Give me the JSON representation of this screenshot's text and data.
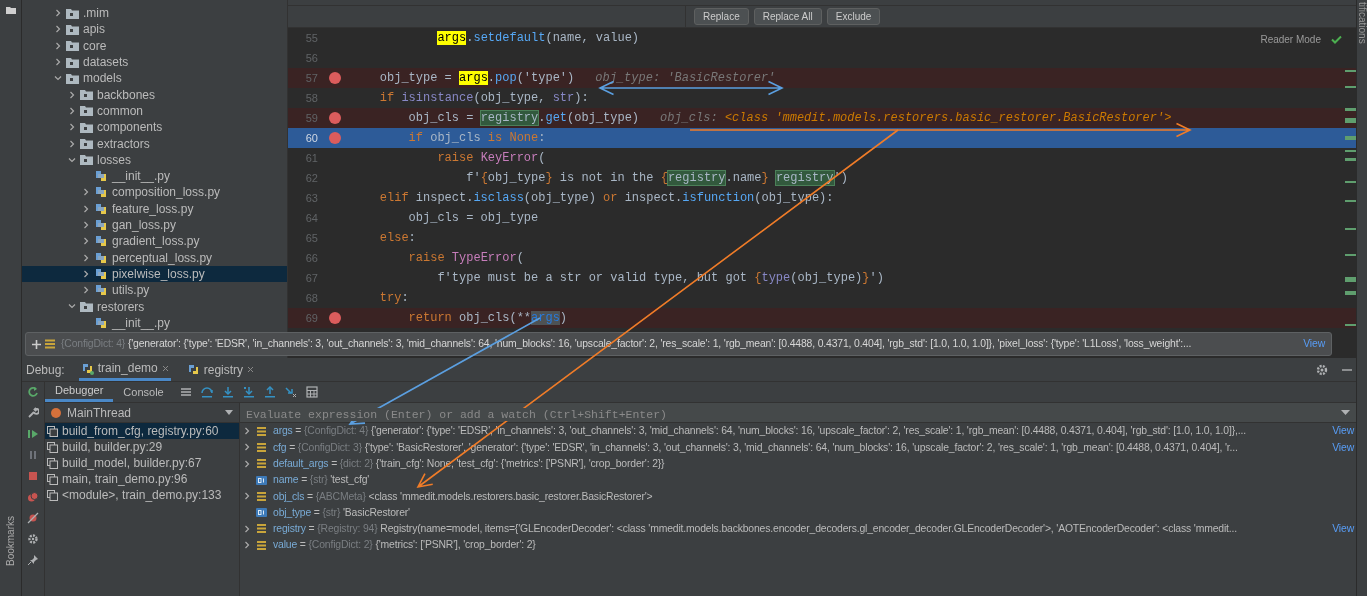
{
  "project_tree": [
    {
      "label": ".mim",
      "kind": "folder",
      "expanded": false,
      "selected": false
    },
    {
      "label": "apis",
      "kind": "folder",
      "expanded": false,
      "selected": false
    },
    {
      "label": "core",
      "kind": "folder",
      "expanded": false,
      "selected": false
    },
    {
      "label": "datasets",
      "kind": "folder",
      "expanded": false,
      "selected": false
    },
    {
      "label": "models",
      "kind": "folder",
      "expanded": true,
      "selected": false,
      "children": [
        {
          "label": "backbones",
          "kind": "folder",
          "expanded": false,
          "selected": false
        },
        {
          "label": "common",
          "kind": "folder",
          "expanded": false,
          "selected": false
        },
        {
          "label": "components",
          "kind": "folder",
          "expanded": false,
          "selected": false
        },
        {
          "label": "extractors",
          "kind": "folder",
          "expanded": false,
          "selected": false
        },
        {
          "label": "losses",
          "kind": "folder",
          "expanded": true,
          "selected": false,
          "children": [
            {
              "label": "__init__.py",
              "kind": "file",
              "selected": false
            },
            {
              "label": "composition_loss.py",
              "kind": "file",
              "expanded": false,
              "selected": false
            },
            {
              "label": "feature_loss.py",
              "kind": "file",
              "expanded": false,
              "selected": false
            },
            {
              "label": "gan_loss.py",
              "kind": "file",
              "expanded": false,
              "selected": false
            },
            {
              "label": "gradient_loss.py",
              "kind": "file",
              "expanded": false,
              "selected": false
            },
            {
              "label": "perceptual_loss.py",
              "kind": "file",
              "expanded": false,
              "selected": false
            },
            {
              "label": "pixelwise_loss.py",
              "kind": "file",
              "expanded": false,
              "selected": true
            },
            {
              "label": "utils.py",
              "kind": "file",
              "expanded": false,
              "selected": false
            }
          ]
        },
        {
          "label": "restorers",
          "kind": "folder",
          "expanded": true,
          "selected": false,
          "children": [
            {
              "label": "__init__.py",
              "kind": "file",
              "selected": false
            }
          ]
        }
      ]
    }
  ],
  "find_bar": {
    "buttons": [
      "Replace",
      "Replace All",
      "Exclude"
    ]
  },
  "editor": {
    "reader_mode": "Reader Mode",
    "lines": [
      {
        "number": "55",
        "breakpoint": false,
        "current": false,
        "tokens": [
          {
            "text": "            args",
            "kind": "match"
          },
          {
            "text": ".",
            "kind": "plain"
          },
          {
            "text": "setdefault",
            "kind": "call"
          },
          {
            "text": "(name, value)",
            "kind": "plain"
          }
        ]
      },
      {
        "number": "56",
        "breakpoint": false,
        "current": false
      },
      {
        "number": "57",
        "breakpoint": true,
        "current": false,
        "tokens": [
          {
            "text": "    obj_type = ",
            "kind": "plain"
          },
          {
            "text": "args",
            "kind": "match"
          },
          {
            "text": ".",
            "kind": "plain"
          },
          {
            "text": "pop",
            "kind": "call"
          },
          {
            "text": "('type')",
            "kind": "plain"
          }
        ],
        "hint": [
          {
            "text": "obj_type: 'BasicRestorer'",
            "kind": "hint"
          }
        ]
      },
      {
        "number": "58",
        "breakpoint": false,
        "current": false,
        "tokens": [
          {
            "text": "    if ",
            "kind": "kw"
          },
          {
            "text": "isinstance",
            "kind": "builtin"
          },
          {
            "text": "(obj_type, ",
            "kind": "plain"
          },
          {
            "text": "str",
            "kind": "builtin"
          },
          {
            "text": "):",
            "kind": "plain"
          }
        ]
      },
      {
        "number": "59",
        "breakpoint": true,
        "current": false,
        "tokens": [
          {
            "text": "        obj_cls = ",
            "kind": "plain"
          },
          {
            "text": "registry",
            "kind": "ref"
          },
          {
            "text": ".",
            "kind": "plain"
          },
          {
            "text": "get",
            "kind": "call"
          },
          {
            "text": "(obj_type)",
            "kind": "plain"
          }
        ],
        "hint": [
          {
            "text": "obj_cls: ",
            "kind": "hint"
          },
          {
            "text": "<class 'mmedit.models.restorers.basic_restorer.BasicRestorer'>",
            "kind": "hint-value"
          }
        ]
      },
      {
        "number": "60",
        "breakpoint": true,
        "current": true,
        "tokens": [
          {
            "text": "        if ",
            "kind": "kw"
          },
          {
            "text": "obj_cls ",
            "kind": "plain"
          },
          {
            "text": "is None",
            "kind": "kw"
          },
          {
            "text": ":",
            "kind": "plain"
          }
        ]
      },
      {
        "number": "61",
        "breakpoint": false,
        "current": false,
        "tokens": [
          {
            "text": "            raise ",
            "kind": "kw"
          },
          {
            "text": "KeyError",
            "kind": "cls"
          },
          {
            "text": "(",
            "kind": "plain"
          }
        ]
      },
      {
        "number": "62",
        "breakpoint": false,
        "current": false,
        "tokens": [
          {
            "text": "                f'",
            "kind": "plain"
          },
          {
            "text": "{",
            "kind": "brace"
          },
          {
            "text": "obj_type",
            "kind": "plain"
          },
          {
            "text": "}",
            "kind": "brace"
          },
          {
            "text": " is not in the ",
            "kind": "plain"
          },
          {
            "text": "{",
            "kind": "brace"
          },
          {
            "text": "registry",
            "kind": "ref"
          },
          {
            "text": ".name",
            "kind": "plain"
          },
          {
            "text": "} ",
            "kind": "brace"
          },
          {
            "text": "registry",
            "kind": "ref"
          },
          {
            "text": "')",
            "kind": "plain"
          }
        ]
      },
      {
        "number": "63",
        "breakpoint": false,
        "current": false,
        "tokens": [
          {
            "text": "    elif ",
            "kind": "kw"
          },
          {
            "text": "inspect.",
            "kind": "plain"
          },
          {
            "text": "isclass",
            "kind": "call"
          },
          {
            "text": "(obj_type) ",
            "kind": "plain"
          },
          {
            "text": "or ",
            "kind": "kw"
          },
          {
            "text": "inspect.",
            "kind": "plain"
          },
          {
            "text": "isfunction",
            "kind": "call"
          },
          {
            "text": "(obj_type):",
            "kind": "plain"
          }
        ]
      },
      {
        "number": "64",
        "breakpoint": false,
        "current": false,
        "tokens": [
          {
            "text": "        obj_cls = obj_type",
            "kind": "plain"
          }
        ]
      },
      {
        "number": "65",
        "breakpoint": false,
        "current": false,
        "tokens": [
          {
            "text": "    else",
            "kind": "kw"
          },
          {
            "text": ":",
            "kind": "plain"
          }
        ]
      },
      {
        "number": "66",
        "breakpoint": false,
        "current": false,
        "tokens": [
          {
            "text": "        raise ",
            "kind": "kw"
          },
          {
            "text": "TypeError",
            "kind": "cls"
          },
          {
            "text": "(",
            "kind": "plain"
          }
        ]
      },
      {
        "number": "67",
        "breakpoint": false,
        "current": false,
        "tokens": [
          {
            "text": "            f'type must be a str or valid type, but got ",
            "kind": "plain"
          },
          {
            "text": "{",
            "kind": "brace"
          },
          {
            "text": "type",
            "kind": "builtin"
          },
          {
            "text": "(obj_type)",
            "kind": "plain"
          },
          {
            "text": "}",
            "kind": "brace"
          },
          {
            "text": "')",
            "kind": "plain"
          }
        ]
      },
      {
        "number": "68",
        "breakpoint": false,
        "current": false,
        "tokens": [
          {
            "text": "    try",
            "kind": "kw"
          },
          {
            "text": ":",
            "kind": "plain"
          }
        ]
      },
      {
        "number": "69",
        "breakpoint": true,
        "current": false,
        "tokens": [
          {
            "text": "        return ",
            "kind": "kw"
          },
          {
            "text": "obj_cls(**",
            "kind": "plain"
          },
          {
            "text": "args",
            "kind": "sel"
          },
          {
            "text": ")",
            "kind": "plain"
          }
        ]
      }
    ]
  },
  "tooltip": {
    "type": "{ConfigDict: 4}",
    "value": "{'generator': {'type': 'EDSR', 'in_channels': 3, 'out_channels': 3, 'mid_channels': 64, 'num_blocks': 16, 'upscale_factor': 2, 'res_scale': 1, 'rgb_mean': [0.4488, 0.4371, 0.404], 'rgb_std': [1.0, 1.0, 1.0]}, 'pixel_loss': {'type': 'L1Loss', 'loss_weight':...",
    "link": "View"
  },
  "annotations": [
    {
      "kind": "double-arrow",
      "color": "#5b9fe0"
    },
    {
      "kind": "arrow",
      "color": "#5b9fe0"
    },
    {
      "kind": "arrow",
      "color": "#f07c28"
    },
    {
      "kind": "arrow",
      "color": "#f07c28"
    }
  ],
  "debug": {
    "label": "Debug:",
    "sessions": [
      {
        "label": "train_demo",
        "selected": true
      },
      {
        "label": "registry",
        "selected": false
      }
    ],
    "tabs": [
      {
        "label": "Debugger",
        "selected": true
      },
      {
        "label": "Console",
        "selected": false
      }
    ],
    "thread": "MainThread",
    "frames": [
      {
        "label": "build_from_cfg, registry.py:60",
        "selected": true
      },
      {
        "label": "build, builder.py:29",
        "selected": false
      },
      {
        "label": "build_model, builder.py:67",
        "selected": false
      },
      {
        "label": "main, train_demo.py:96",
        "selected": false
      },
      {
        "label": "<module>, train_demo.py:133",
        "selected": false
      }
    ],
    "evaluate_placeholder": "Evaluate expression (Enter) or add a watch (Ctrl+Shift+Enter)",
    "variables": [
      {
        "name": "args",
        "operator": "=",
        "type": "{ConfigDict: 4}",
        "kind": "dict",
        "value": "{'generator': {'type': 'EDSR', 'in_channels': 3, 'out_channels': 3, 'mid_channels': 64, 'num_blocks': 16, 'upscale_factor': 2, 'res_scale': 1, 'rgb_mean': [0.4488, 0.4371, 0.404], 'rgb_std': [1.0, 1.0, 1.0]},...",
        "link": "View"
      },
      {
        "name": "cfg",
        "operator": "=",
        "type": "{ConfigDict: 3}",
        "kind": "dict",
        "value": "{'type': 'BasicRestorer', 'generator': {'type': 'EDSR', 'in_channels': 3, 'out_channels': 3, 'mid_channels': 64, 'num_blocks': 16, 'upscale_factor': 2, 'res_scale': 1, 'rgb_mean': [0.4488, 0.4371, 0.404], 'r...",
        "link": "View"
      },
      {
        "name": "default_args",
        "operator": "=",
        "type": "{dict: 2}",
        "kind": "dict",
        "value": "{'train_cfg': None, 'test_cfg': {'metrics': ['PSNR'], 'crop_border': 2}}"
      },
      {
        "name": "name",
        "operator": "=",
        "type": "{str}",
        "kind": "str",
        "value": "'test_cfg'"
      },
      {
        "name": "obj_cls",
        "operator": "=",
        "type": "{ABCMeta}",
        "kind": "dict",
        "value": "<class 'mmedit.models.restorers.basic_restorer.BasicRestorer'>"
      },
      {
        "name": "obj_type",
        "operator": "=",
        "type": "{str}",
        "kind": "str",
        "value": "'BasicRestorer'"
      },
      {
        "name": "registry",
        "operator": "=",
        "type": "{Registry: 94}",
        "kind": "dict",
        "value": "Registry(name=model, items={'GLEncoderDecoder': <class 'mmedit.models.backbones.encoder_decoders.gl_encoder_decoder.GLEncoderDecoder'>, 'AOTEncoderDecoder': <class 'mmedit...",
        "link": "View"
      },
      {
        "name": "value",
        "operator": "=",
        "type": "{ConfigDict: 2}",
        "kind": "dict",
        "value": "{'metrics': ['PSNR'], 'crop_border': 2}"
      }
    ]
  },
  "side_labels": {
    "bookmarks": "Bookmarks",
    "notifications": "tifications"
  }
}
